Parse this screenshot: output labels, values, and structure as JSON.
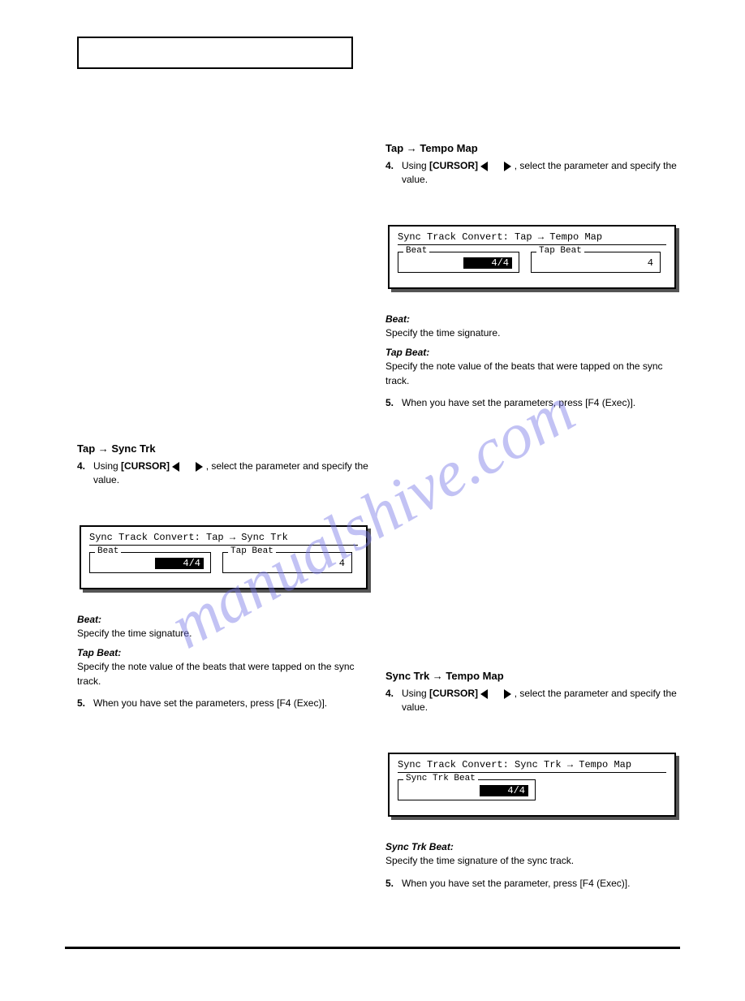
{
  "watermark": "manualshive.com",
  "section_title": "",
  "s1": {
    "heading": "Tap → Tempo Map",
    "p1a": "Using ",
    "p1b": "[CURSOR] ",
    "p1c": ", select the parameter and specify the value.",
    "beat_label": "Beat:",
    "beat_desc": "Specify the time signature.",
    "tapbeat_label": "Tap Beat:",
    "tapbeat_desc": "Specify the note value of the beats that were tapped on the sync track.",
    "end": "When you have set the parameters, press [F4 (Exec)]."
  },
  "s2": {
    "heading": "Tap → Sync Trk",
    "p1a": "Using ",
    "p1b": "[CURSOR] ",
    "p1c": ", select the parameter and specify the value.",
    "beat_label": "Beat:",
    "beat_desc": "Specify the time signature.",
    "tapbeat_label": "Tap Beat:",
    "tapbeat_desc": "Specify the note value of the beats that were tapped on the sync track.",
    "end": "When you have set the parameters, press [F4 (Exec)]."
  },
  "s3": {
    "heading": "Sync Trk → Tempo Map",
    "p1a": "Using ",
    "p1b": "[CURSOR] ",
    "p1c": ", select the parameter and specify the value.",
    "beat_label": "Sync Trk Beat:",
    "beat_desc": "Specify the time signature of the sync track.",
    "end": "When you have set the parameter, press [F4 (Exec)]."
  },
  "ui1": {
    "title_a": "Sync Track Convert: Tap ",
    "title_b": " Tempo Map",
    "beat_legend": "Beat",
    "beat_val": "4/4",
    "tap_legend": "Tap Beat",
    "tap_val": "4"
  },
  "ui2": {
    "title_a": "Sync Track Convert: Tap ",
    "title_b": " Sync Trk",
    "beat_legend": "Beat",
    "beat_val": "4/4",
    "tap_legend": "Tap Beat",
    "tap_val": "4"
  },
  "ui3": {
    "title_a": "Sync Track Convert: Sync Trk ",
    "title_b": " Tempo Map",
    "beat_legend": "Sync Trk Beat",
    "beat_val": "4/4"
  },
  "footer_left": "",
  "footer_right": ""
}
